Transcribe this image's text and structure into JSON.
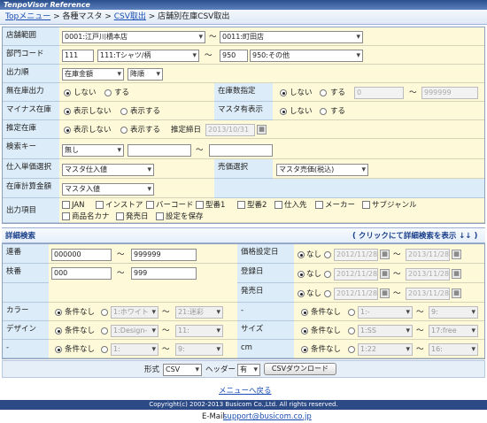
{
  "app": {
    "title": "TenpoVisor Reference"
  },
  "breadcrumb": {
    "top": "Topメニュー",
    "sep1": " > ",
    "masters": "各種マスタ",
    "sep2": " > ",
    "csv": "CSV取出",
    "sep3": " > ",
    "current": "店舗別在庫CSV取出"
  },
  "form": {
    "store_range": {
      "label": "店舗範囲",
      "from": "0001:江戸川橋本店",
      "to": "0011:町田店",
      "tilde": "〜"
    },
    "dept": {
      "label": "部門コード",
      "from_code": "111",
      "from_name": "111:Tシャツ/柄",
      "to_code": "950",
      "to_name": "950:その他",
      "tilde": "〜"
    },
    "order": {
      "label": "出力順",
      "field": "在庫金額",
      "direction": "降順"
    },
    "no_stock": {
      "label": "無在庫出力",
      "opt_no": "しない",
      "opt_yes": "する"
    },
    "stock_count": {
      "label": "在庫数指定",
      "opt_no": "しない",
      "opt_yes": "する",
      "from": "0",
      "to": "999999",
      "tilde": "〜"
    },
    "minus": {
      "label": "マイナス在庫",
      "opt_hide": "表示しない",
      "opt_show": "表示する"
    },
    "master_disp": {
      "label": "マスタ有表示",
      "opt_no": "しない",
      "opt_yes": "する"
    },
    "estimate": {
      "label": "推定在庫",
      "opt_hide": "表示しない",
      "opt_show": "表示する",
      "date_label": "推定締日",
      "date": "2013/10/31"
    },
    "search_key": {
      "label": "検索キー",
      "value": "無し",
      "tilde": "〜"
    },
    "purchase_price": {
      "label": "仕入単価選択",
      "value": "マスタ仕入値"
    },
    "sell_price": {
      "label": "売価選択",
      "value": "マスタ売価(税込)"
    },
    "stock_calc": {
      "label": "在庫計算金額",
      "value": "マスタ入値"
    },
    "output_items": {
      "label": "出力項目",
      "items": [
        "JAN",
        "インストア",
        "バーコード",
        "型番1",
        "型番2",
        "仕入先",
        "メーカー",
        "サブジャンル",
        "商品名カナ",
        "発売日",
        "設定を保存"
      ]
    }
  },
  "detail": {
    "title": "詳細検索",
    "toggle": "( クリックにて詳細検索を表示 ↓↓ )",
    "serial": {
      "label": "連番",
      "from": "000000",
      "to": "999999",
      "tilde": "〜"
    },
    "branch": {
      "label": "枝番",
      "from": "000",
      "to": "999",
      "tilde": "〜"
    },
    "price_date": {
      "label": "価格設定日",
      "opt": "なし",
      "from": "2012/11/28",
      "to": "2013/11/28",
      "tilde": "〜"
    },
    "reg_date": {
      "label": "登録日",
      "opt": "なし",
      "from": "2012/11/28",
      "to": "2013/11/28",
      "tilde": "〜"
    },
    "release_date": {
      "label": "発売日",
      "opt": "なし",
      "from": "2012/11/28",
      "to": "2013/11/28",
      "tilde": "〜"
    },
    "color": {
      "label": "カラー",
      "opt": "条件なし",
      "from": "1:ホワイト",
      "to": "21:迷彩",
      "tilde": "〜"
    },
    "color_r": {
      "label": "-",
      "opt": "条件なし",
      "from": "1:-",
      "to": "9:",
      "tilde": "〜"
    },
    "design": {
      "label": "デザイン",
      "opt": "条件なし",
      "from": "1:Design-",
      "to": "11:",
      "tilde": "〜"
    },
    "size": {
      "label": "サイズ",
      "opt": "条件なし",
      "from": "1:SS",
      "to": "17:free",
      "tilde": "〜"
    },
    "dash_l": {
      "label": "-",
      "opt": "条件なし",
      "from": "1:",
      "to": "9:",
      "tilde": "〜"
    },
    "cm": {
      "label": "cm",
      "opt": "条件なし",
      "from": "1:22",
      "to": "16:",
      "tilde": "〜"
    }
  },
  "actions": {
    "format_label": "形式",
    "format": "CSV",
    "header_label": "ヘッダー",
    "header": "有",
    "download": "CSVダウンロード",
    "back": "メニューへ戻る"
  },
  "footer": {
    "copyright": "Copyright(c) 2002-2013 Busicom Co.,Ltd. All rights reserved.",
    "email_label": "E-Mail",
    "email": "support@busicom.co.jp"
  }
}
